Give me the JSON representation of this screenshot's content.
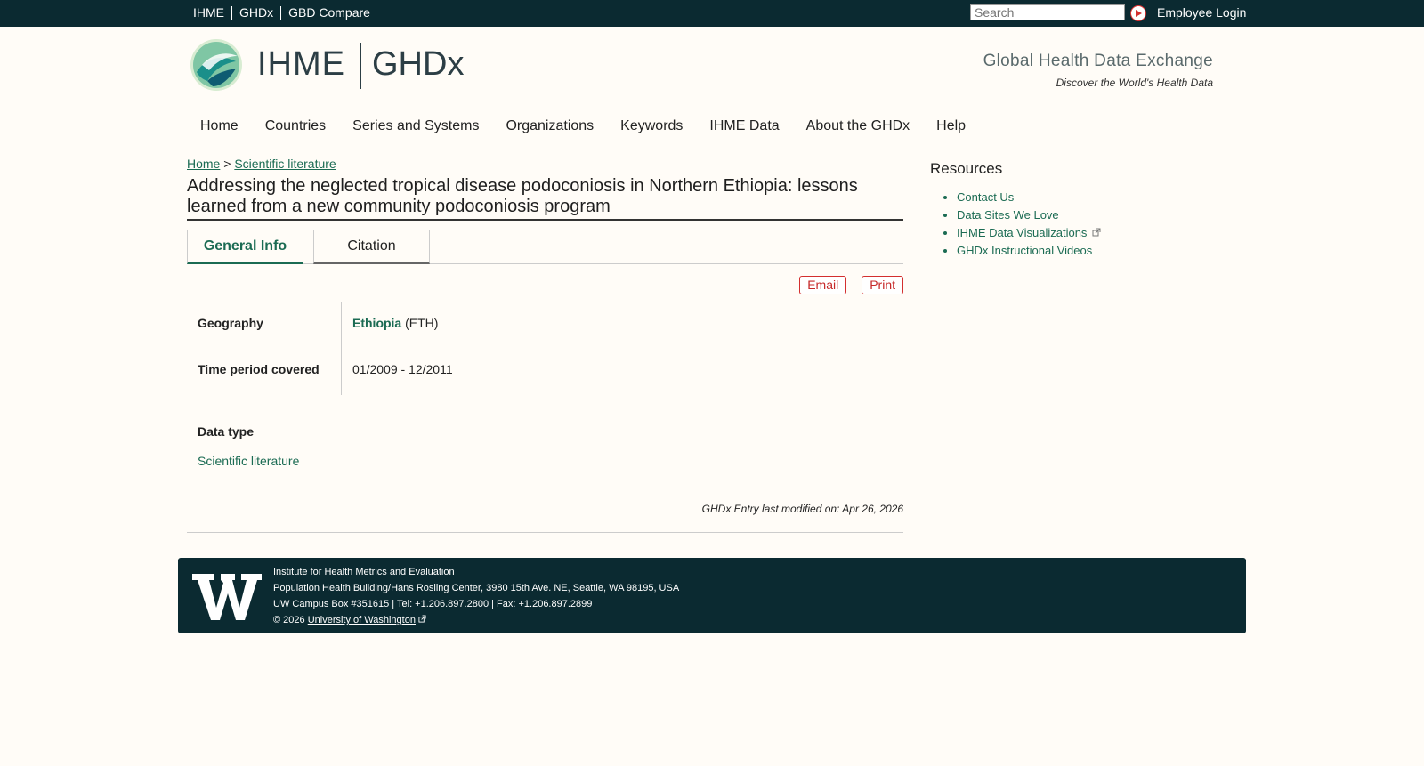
{
  "topnav": {
    "links": [
      "IHME",
      "GHDx",
      "GBD Compare"
    ],
    "search_placeholder": "Search",
    "login": "Employee Login"
  },
  "header": {
    "logo_ihme": "IHME",
    "logo_ghdx": "GHDx",
    "tagline": "Global Health Data Exchange",
    "subtagline": "Discover the World's Health Data"
  },
  "mainnav": [
    "Home",
    "Countries",
    "Series and Systems",
    "Organizations",
    "Keywords",
    "IHME Data",
    "About the GHDx",
    "Help"
  ],
  "breadcrumb": {
    "home": "Home",
    "separator": ">",
    "section": "Scientific literature"
  },
  "page_title": "Addressing the neglected tropical disease podoconiosis in Northern Ethiopia: lessons learned from a new community podoconiosis program",
  "tabs": [
    "General Info",
    "Citation"
  ],
  "actions": {
    "email": "Email",
    "print": "Print"
  },
  "details": {
    "geography_label": "Geography",
    "geography_link": "Ethiopia",
    "geography_code": "(ETH)",
    "time_label": "Time period covered",
    "time_value": "01/2009 - 12/2011",
    "datatype_label": "Data type",
    "datatype_value": "Scientific literature"
  },
  "modified": "GHDx Entry last modified on: Apr 26, 2026",
  "sidebar": {
    "title": "Resources",
    "links": [
      "Contact Us",
      "Data Sites We Love",
      "IHME Data Visualizations",
      "GHDx Instructional Videos"
    ]
  },
  "footer": {
    "line1": "Institute for Health Metrics and Evaluation",
    "line2": "Population Health Building/Hans Rosling Center, 3980 15th Ave. NE, Seattle, WA 98195, USA",
    "line3": "UW Campus Box #351615 | Tel: +1.206.897.2800 | Fax: +1.206.897.2899",
    "copyright": "© 2026",
    "uw_link": "University of Washington"
  },
  "colors": {
    "topbar": "#0b2a31",
    "link": "#1b6b53",
    "accent_red": "#d32f2f",
    "background": "#fffcf7"
  }
}
